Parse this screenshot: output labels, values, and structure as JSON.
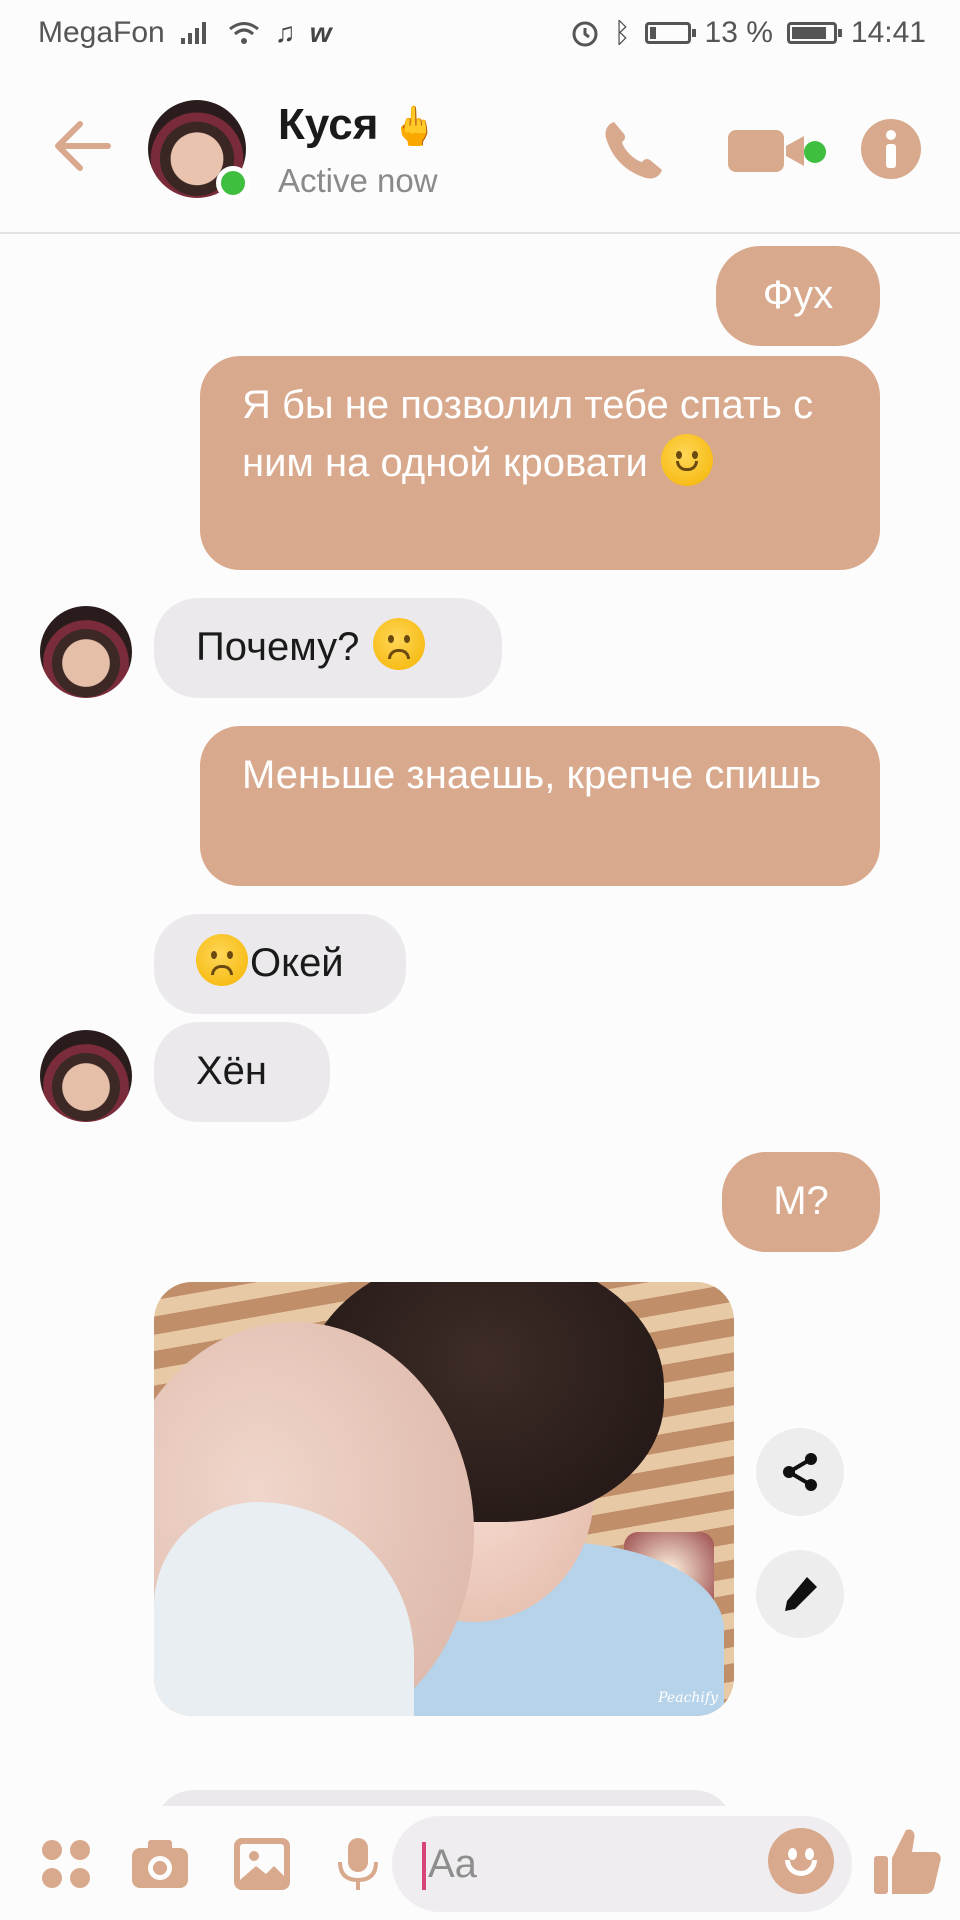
{
  "status_bar": {
    "carrier": "MegaFon",
    "battery_percent": "13 %",
    "time": "14:41",
    "icons": [
      "signal-icon",
      "wifi-icon",
      "music-note-icon",
      "w-app-icon",
      "alarm-icon",
      "bluetooth-icon",
      "battery-icon",
      "charging-battery-icon"
    ]
  },
  "header": {
    "contact_name": "Куся",
    "name_emoji": "🖕",
    "status": "Active now",
    "online": true,
    "accent_color": "#d8a98c",
    "online_color": "#3fbf3f"
  },
  "messages": [
    {
      "side": "out",
      "text": "Фух"
    },
    {
      "side": "out",
      "text": "Я бы не позволил тебе спать с ним на одной кровати",
      "emoji": "relieved-face"
    },
    {
      "side": "in",
      "text": "Почему?",
      "emoji": "frowning-face"
    },
    {
      "side": "out",
      "text": "Меньше знаешь, крепче спишь"
    },
    {
      "side": "in",
      "text": "Окей",
      "emoji": "frowning-face",
      "emoji_position": "before"
    },
    {
      "side": "in",
      "text": "Хён"
    },
    {
      "side": "out",
      "text": "М?"
    },
    {
      "side": "in",
      "type": "photo",
      "watermark": "Peachify"
    }
  ],
  "composer": {
    "placeholder": "Aa"
  }
}
